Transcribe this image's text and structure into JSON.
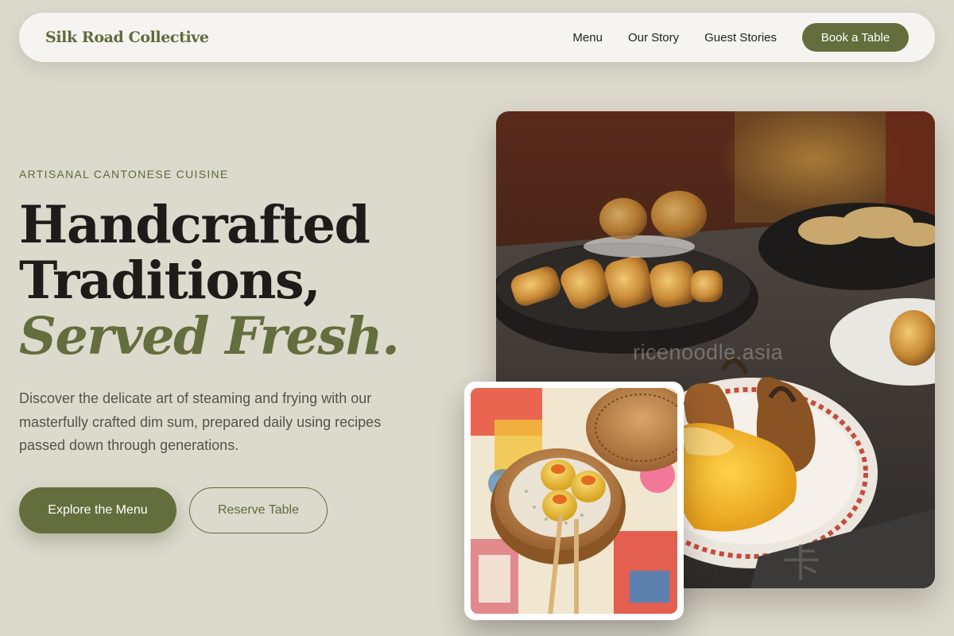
{
  "nav": {
    "brand": "Silk Road Collective",
    "links": [
      "Menu",
      "Our Story",
      "Guest Stories"
    ],
    "cta": "Book a Table"
  },
  "hero": {
    "eyebrow": "ARTISANAL CANTONESE CUISINE",
    "headline_line1": "Handcrafted",
    "headline_line2": "Traditions,",
    "headline_accent": "Served Fresh.",
    "description": "Discover the delicate art of steaming and frying with our masterfully crafted dim sum, prepared daily using recipes passed down through generations.",
    "primary_button": "Explore the Menu",
    "secondary_button": "Reserve Table"
  },
  "images": {
    "main_photo": "fried dim sum platter photo",
    "main_watermark": "ricenoodle.asia",
    "inset_photo": "siu mai in bamboo steamer photo"
  },
  "colors": {
    "background": "#dcd9cd",
    "accent": "#646d3c",
    "nav_background": "#f5f4f1",
    "text_dark": "#1d1c19",
    "text_muted": "#55534c"
  }
}
